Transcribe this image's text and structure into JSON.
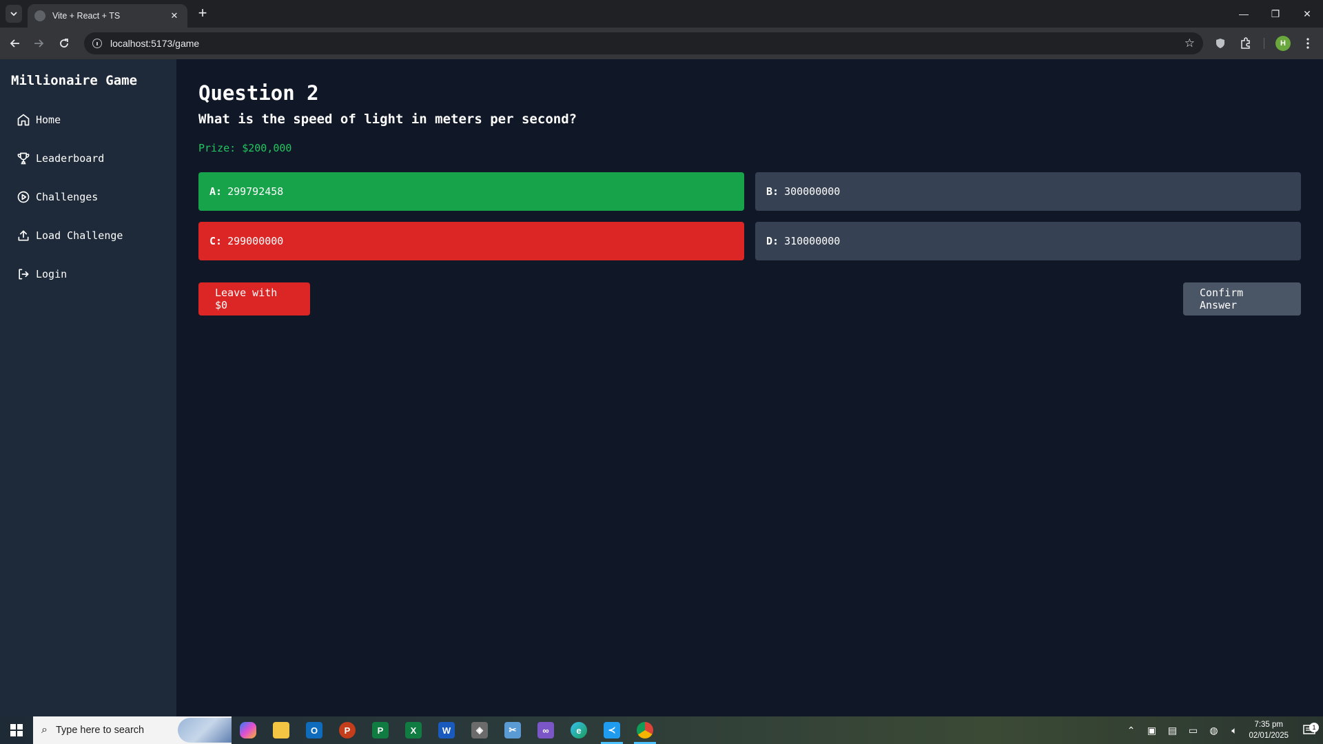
{
  "browser": {
    "tab_title": "Vite + React + TS",
    "url": "localhost:5173/game",
    "profile_initial": "H"
  },
  "sidebar": {
    "brand": "Millionaire Game",
    "items": [
      {
        "label": "Home",
        "icon": "home-icon"
      },
      {
        "label": "Leaderboard",
        "icon": "trophy-icon"
      },
      {
        "label": "Challenges",
        "icon": "play-circle-icon"
      },
      {
        "label": "Load Challenge",
        "icon": "upload-icon"
      },
      {
        "label": "Login",
        "icon": "login-icon"
      }
    ]
  },
  "game": {
    "question_title": "Question 2",
    "question_text": "What is the speed of light in meters per second?",
    "prize": "Prize: $200,000",
    "answers": [
      {
        "letter": "A:",
        "value": "299792458",
        "state": "correct",
        "color": "#17a34a"
      },
      {
        "letter": "B:",
        "value": "300000000",
        "state": "neutral",
        "color": "#364153"
      },
      {
        "letter": "C:",
        "value": "299000000",
        "state": "wrong",
        "color": "#dc2626"
      },
      {
        "letter": "D:",
        "value": "310000000",
        "state": "neutral",
        "color": "#364153"
      }
    ],
    "leave_label": "Leave with $0",
    "confirm_label": "Confirm Answer"
  },
  "taskbar": {
    "search_placeholder": "Type here to search",
    "time": "7:35 pm",
    "date": "02/01/2025",
    "notification_count": "1"
  }
}
